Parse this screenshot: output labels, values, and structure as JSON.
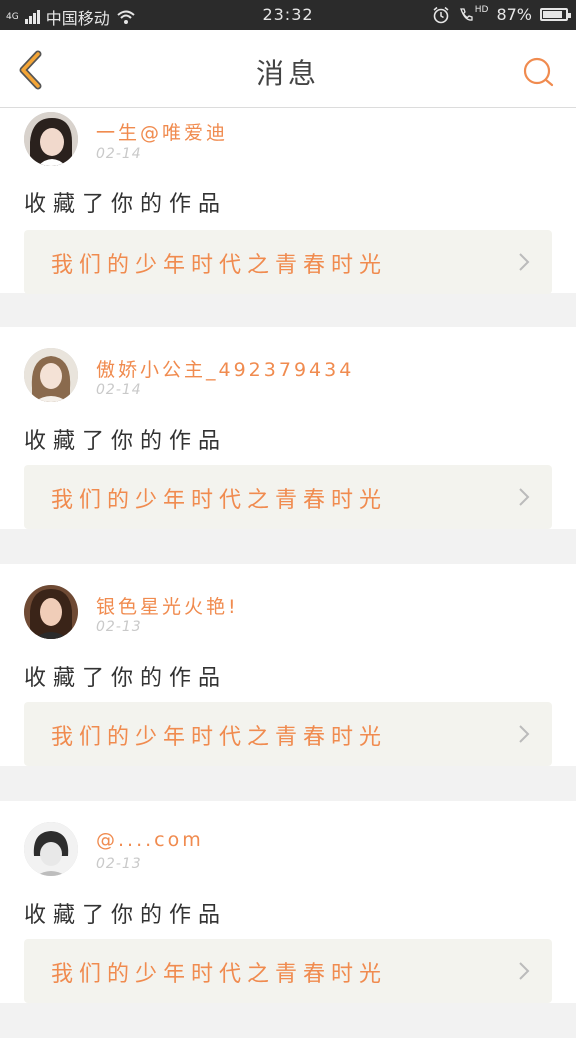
{
  "status_bar": {
    "network_badge": "4G",
    "carrier": "中国移动",
    "time": "23:32",
    "hd_label": "HD",
    "battery_percent_text": "87%",
    "battery_level": 0.87
  },
  "nav": {
    "title": "消息",
    "accent_color": "#f4a536",
    "search_color": "#f08b4f"
  },
  "messages": [
    {
      "user": "一生@唯爱迪",
      "date": "02-14",
      "action": "收藏了你的作品",
      "work_title": "我们的少年时代之青春时光",
      "avatar_icon": "avatar-1"
    },
    {
      "user": "傲娇小公主_492379434",
      "date": "02-14",
      "action": "收藏了你的作品",
      "work_title": "我们的少年时代之青春时光",
      "avatar_icon": "avatar-2"
    },
    {
      "user": "银色星光火艳!",
      "date": "02-13",
      "action": "收藏了你的作品",
      "work_title": "我们的少年时代之青春时光",
      "avatar_icon": "avatar-3"
    },
    {
      "user": "@....com",
      "date": "02-13",
      "action": "收藏了你的作品",
      "work_title": "我们的少年时代之青春时光",
      "avatar_icon": "avatar-4"
    }
  ]
}
